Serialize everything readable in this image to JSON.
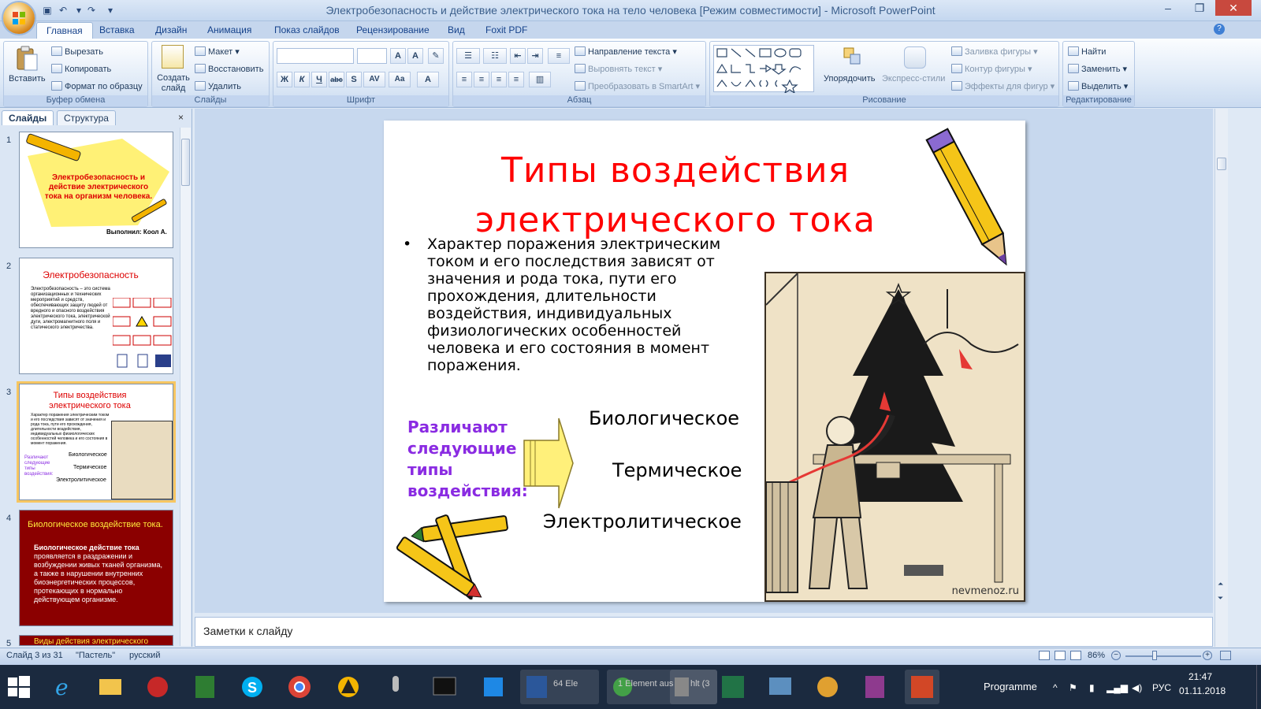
{
  "window": {
    "title": "Электробезопасность и действие электрического тока на тело человека [Режим совместимости] - Microsoft PowerPoint"
  },
  "tabs": [
    "Главная",
    "Вставка",
    "Дизайн",
    "Анимация",
    "Показ слайдов",
    "Рецензирование",
    "Вид",
    "Foxit PDF"
  ],
  "ribbon": {
    "clipboard": {
      "label": "Буфер обмена",
      "paste": "Вставить",
      "cut": "Вырезать",
      "copy": "Копировать",
      "format_painter": "Формат по образцу"
    },
    "slides": {
      "label": "Слайды",
      "create": "Создать слайд",
      "layout": "Макет",
      "reset": "Восстановить",
      "delete": "Удалить"
    },
    "font": {
      "label": "Шрифт"
    },
    "paragraph": {
      "label": "Абзац",
      "text_direction": "Направление текста",
      "align_text": "Выровнять текст",
      "smartart": "Преобразовать в SmartArt"
    },
    "drawing": {
      "label": "Рисование",
      "arrange": "Упорядочить",
      "quick_styles": "Экспресс-стили",
      "fill": "Заливка фигуры",
      "outline": "Контур фигуры",
      "effects": "Эффекты для фигур"
    },
    "editing": {
      "label": "Редактирование",
      "find": "Найти",
      "replace": "Заменить",
      "select": "Выделить"
    }
  },
  "left_pane": {
    "tab_slides": "Слайды",
    "tab_outline": "Структура",
    "thumbs": [
      {
        "num": "1",
        "title": "Электробезопасность и действие электрического тока на организм человека.",
        "author": "Выполнил: Коол А."
      },
      {
        "num": "2",
        "title": "Электробезопасность",
        "body": "Электробезопасность – это система организационных и технических мероприятий и средств, обеспечивающих защиту людей от вредного и опасного воздействия электрического тока, электрической дуги, электромагнитного поля и статического электричества."
      },
      {
        "num": "3",
        "title": "Типы воздействия электрического тока"
      },
      {
        "num": "4",
        "title": "Биологическое воздействие тока.",
        "body_bold": "Биологическое действие тока",
        "body": "проявляется в раздражении и возбуждении живых тканей организма, а также в нарушении внутренних биоэнергетических процессов, протекающих в нормально действующем организме."
      },
      {
        "num": "5",
        "title": "Виды действия электрического"
      }
    ]
  },
  "slide": {
    "title_line1": "Типы воздействия",
    "title_line2": "электрического тока",
    "body": "Характер поражения электрическим током и его последствия зависят от значения и рода тока, пути его прохождения, длительности воздействия, индивидуальных физиологических особенностей человека и его состояния в момент поражения.",
    "kinds_label": "Различают следующие типы воздействия:",
    "kinds": [
      "Биологическое",
      "Термическое",
      "Электролитическое"
    ],
    "photo_credit": "nevmenoz.ru"
  },
  "notes": {
    "placeholder": "Заметки к слайду"
  },
  "status": {
    "slide": "Слайд 3 из 31",
    "theme": "\"Пастель\"",
    "language": "русский",
    "zoom": "86%"
  },
  "taskbar": {
    "programme": "Programme",
    "lang": "РУС",
    "time": "21:47",
    "date": "01.11.2018",
    "item1": "64 Ele",
    "item2": "1 Element aus",
    "item3": "hlt (3"
  },
  "colors": {
    "title_red": "#ff0000",
    "kinds_purple": "#8a2be2",
    "selection": "#f7c661",
    "ribbon_blue": "#15428b"
  }
}
